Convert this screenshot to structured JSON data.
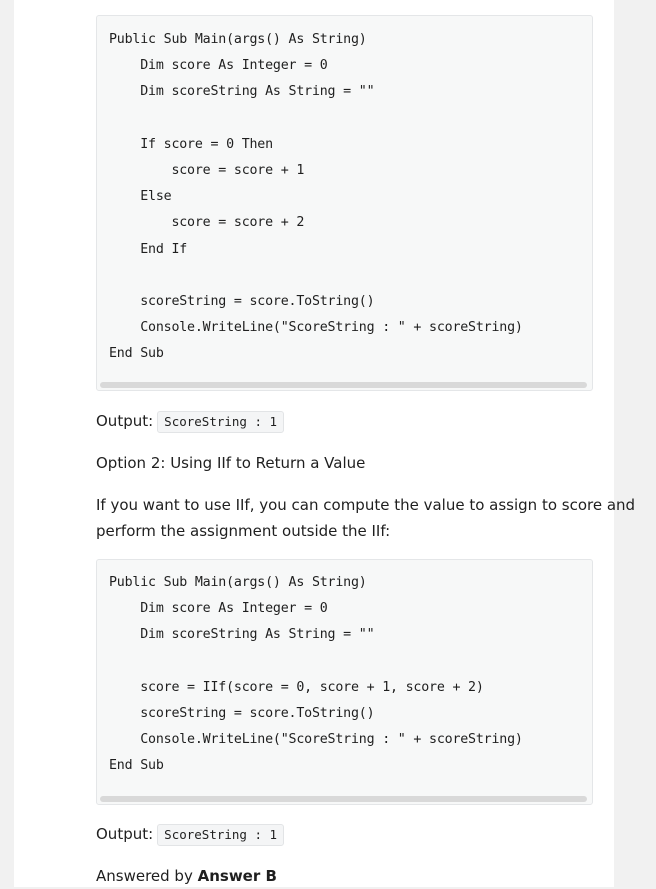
{
  "code1": [
    "Public Sub Main(args() As String)",
    "    Dim score As Integer = 0",
    "    Dim scoreString As String = \"\"",
    "",
    "    If score = 0 Then",
    "        score = score + 1",
    "    Else",
    "        score = score + 2",
    "    End If",
    "",
    "    scoreString = score.ToString()",
    "    Console.WriteLine(\"ScoreString : \" + scoreString)",
    "End Sub"
  ],
  "output1": {
    "label": "Output:",
    "code": "ScoreString : 1"
  },
  "option2_heading": "Option 2: Using IIf to Return a Value",
  "option2_para_line1": "If you want to use IIf, you can compute the value to assign to score and",
  "option2_para_line2": "perform the assignment outside the IIf:",
  "code2": [
    "Public Sub Main(args() As String)",
    "    Dim score As Integer = 0",
    "    Dim scoreString As String = \"\"",
    "",
    "    score = IIf(score = 0, score + 1, score + 2)",
    "    scoreString = score.ToString()",
    "    Console.WriteLine(\"ScoreString : \" + scoreString)",
    "End Sub"
  ],
  "output2": {
    "label": "Output:",
    "code": "ScoreString : 1"
  },
  "answered_by": {
    "prefix": "Answered by ",
    "name": "Answer B"
  }
}
